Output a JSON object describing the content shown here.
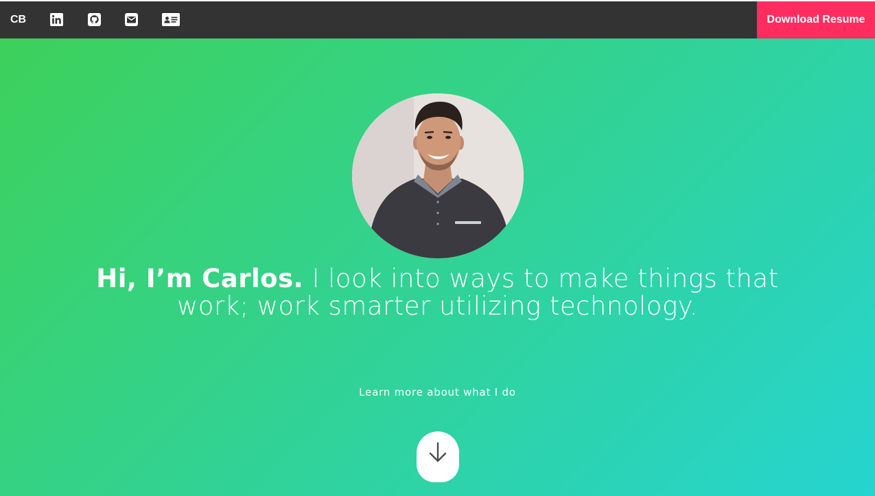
{
  "navbar": {
    "brand": "CB",
    "icons": [
      {
        "name": "linkedin-icon"
      },
      {
        "name": "github-icon"
      },
      {
        "name": "envelope-icon"
      },
      {
        "name": "id-card-icon"
      }
    ],
    "resume_button": "Download Resume",
    "background_color": "#333333",
    "accent_color": "#ff2d5f"
  },
  "hero": {
    "avatar_alt": "Carlos",
    "headline_name": "Hi, I’m Carlos.",
    "headline_rest": " I look into ways to make things that work; work smarter utilizing technology.",
    "learn_more": "Learn more about what I do",
    "scroll_icon": "arrow-down-icon",
    "gradient_start": "#3dd15a",
    "gradient_end": "#26d4d0"
  }
}
